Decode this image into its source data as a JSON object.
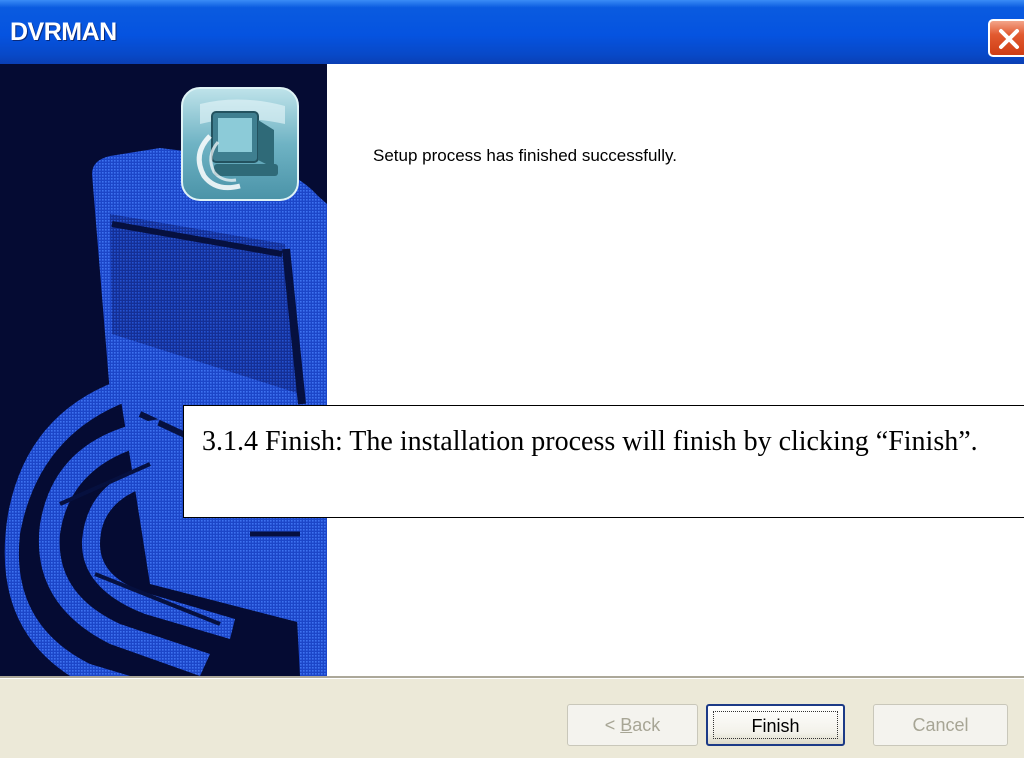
{
  "window": {
    "title": "DVRMAN",
    "close_icon": "close-icon"
  },
  "sidebar": {
    "artwork": "installer-banner-artwork",
    "logo_icon": "computer-logo-icon"
  },
  "content": {
    "message": "Setup process has finished successfully."
  },
  "buttons": {
    "back_prefix": "< ",
    "back_mnemonic": "B",
    "back_rest": "ack",
    "finish": "Finish",
    "cancel": "Cancel"
  },
  "caption": {
    "text": "3.1.4 Finish: The installation process will finish by clicking “Finish”."
  },
  "colors": {
    "titlebar": "#0553e0",
    "sidebar_bg": "#050b33",
    "sidebar_art": "#1e4fd8",
    "close_button": "#e25a30",
    "footer": "#ece9d8"
  }
}
